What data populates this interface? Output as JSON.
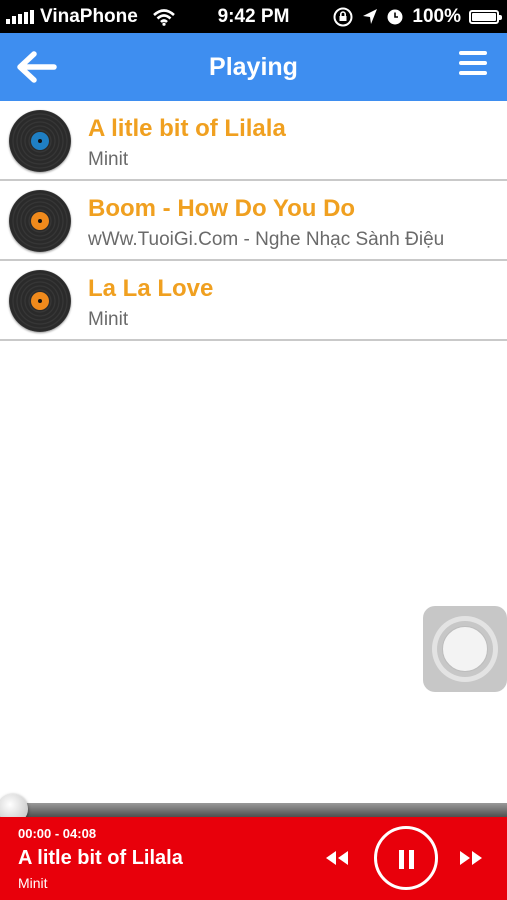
{
  "status_bar": {
    "carrier": "VinaPhone",
    "time": "9:42 PM",
    "battery": "100%",
    "battery_level": 1.0
  },
  "header": {
    "title": "Playing",
    "back_icon": "back-arrow-icon",
    "menu_icon": "hamburger-menu-icon"
  },
  "songs": [
    {
      "title": "A litle bit of Lilala",
      "artist": "Minit",
      "disc_color": "#1f7fc4"
    },
    {
      "title": "Boom - How Do You Do",
      "artist": "wWw.TuoiGi.Com - Nghe Nhạc Sành Điệu",
      "disc_color": "#f08a1c"
    },
    {
      "title": "La La Love",
      "artist": "Minit",
      "disc_color": "#f08a1c"
    }
  ],
  "player": {
    "time": "00:00 - 04:08",
    "title": "A litle bit of Lilala",
    "artist": "Minit",
    "progress": 0,
    "rewind_icon": "rewind-icon",
    "pause_icon": "pause-icon",
    "forward_icon": "fast-forward-icon"
  },
  "colors": {
    "header_bg": "#3e8ef0",
    "title_orange": "#f0a020",
    "player_red": "#e8000b"
  }
}
